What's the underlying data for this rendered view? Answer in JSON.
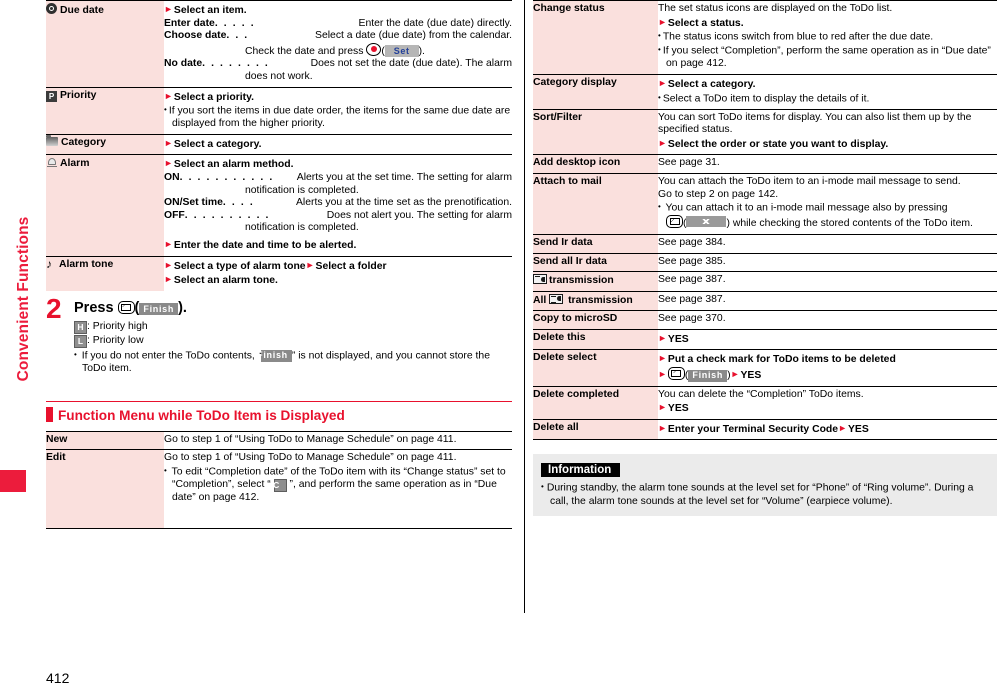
{
  "chapter": {
    "label": "Convenient Functions"
  },
  "page": {
    "number": "412"
  },
  "left_table": {
    "rows": [
      {
        "icon": "due-date-icon",
        "term": "Due date",
        "head": "Select an item.",
        "defs": [
          {
            "term": "Enter date",
            "dots": ". . . . .",
            "body": "Enter the date (due date) directly."
          },
          {
            "term": "Choose date",
            "dots": ". . .",
            "body": "Select a date (due date) from the calendar.",
            "cont_pre": "Check the date and press ",
            "cont_key": "center-key",
            "cont_soft": "Set",
            "cont_post": ")."
          },
          {
            "term": "No date",
            "dots": ". . . . . . . .",
            "body": "Does not set the date (due date). The alarm",
            "cont": "does not work."
          }
        ]
      },
      {
        "icon": "priority-icon",
        "term": "Priority",
        "head": "Select a priority.",
        "notes": [
          "If you sort the items in due date order, the items for the same due date are displayed from the higher priority."
        ]
      },
      {
        "icon": "category-folder-icon",
        "term": "Category",
        "head": "Select a category."
      },
      {
        "icon": "alarm-bell-icon",
        "term": "Alarm",
        "head": "Select an alarm method.",
        "defs": [
          {
            "term": "ON",
            "dots": ". . . . . . . . . . .",
            "body": "Alerts you at the set time. The setting for alarm",
            "cont": "notification is completed."
          },
          {
            "term": "ON/Set time",
            "dots": ". . . .",
            "body": "Alerts you at the time set as the prenotification."
          },
          {
            "term": "OFF",
            "dots": ". . . . . . . . . .",
            "body": "Does not alert you. The setting for alarm",
            "cont": "notification is completed."
          }
        ],
        "head2": "Enter the date and time to be alerted."
      },
      {
        "icon": "music-note-icon",
        "term": "Alarm tone",
        "head": "Select a type of alarm tone",
        "head_b": "Select a folder",
        "head2": "Select an alarm tone."
      }
    ]
  },
  "step": {
    "number": "2",
    "title_pre": "Press ",
    "title_key": "mail-key",
    "title_soft": "Finish",
    "title_post": ").",
    "lines": [
      {
        "icon": "H",
        "text": ": Priority high"
      },
      {
        "icon": "L",
        "text": ": Priority low"
      }
    ],
    "note_pre": "If you do not enter the ToDo contents, “",
    "note_soft": "Finish",
    "note_post": "” is not displayed, and you cannot store the ToDo item."
  },
  "section_header": {
    "title": "Function Menu while ToDo Item is Displayed"
  },
  "left_table2": {
    "rows": [
      {
        "term": "New",
        "body": "Go to step 1 of “Using ToDo to Manage Schedule” on page 411."
      },
      {
        "term": "Edit",
        "body": "Go to step 1 of “Using ToDo to Manage Schedule” on page 411.",
        "note_pre": "To edit “Completion date” of the ToDo item with its “Change status” set to “Completion”, select “ ",
        "note_icon": "C",
        "note_post": " ”, and perform the same operation as in “Due date” on page 412."
      }
    ]
  },
  "right_table": {
    "rows": [
      {
        "term": "Change status",
        "body": "The set status icons are displayed on the ToDo list.",
        "head": "Select a status.",
        "notes": [
          "The status icons switch from blue to red after the due date.",
          "If you select “Completion”, perform the same operation as in “Due date” on page 412."
        ]
      },
      {
        "term": "Category display",
        "head": "Select a category.",
        "notes": [
          "Select a ToDo item to display the details of it."
        ]
      },
      {
        "term": "Sort/Filter",
        "body": "You can sort ToDo items for display. You can also list them up by the specified status.",
        "head": "Select the order or state you want to display."
      },
      {
        "term": "Add desktop icon",
        "body": "See page 31."
      },
      {
        "term": "Attach to mail",
        "body": "You can attach the ToDo item to an i-mode mail message to send.",
        "body2": "Go to step 2 on page 142.",
        "note_pre": "You can attach it to an i-mode mail message also by pressing",
        "note_key": "mail-key",
        "note_soft": "mail-softkey",
        "note_post": ") while checking the stored contents of the ToDo item."
      },
      {
        "term": "Send Ir data",
        "body": "See page 384."
      },
      {
        "term": "Send all Ir data",
        "body": "See page 385."
      },
      {
        "term_icon": "transmission-icon",
        "term": "transmission",
        "body": "See page 387."
      },
      {
        "term_pre": "All",
        "term_icon": "transmission-icon",
        "term": "transmission",
        "body": "See page 387."
      },
      {
        "term": "Copy to microSD",
        "body": "See page 370."
      },
      {
        "term": "Delete this",
        "head": "YES"
      },
      {
        "term": "Delete select",
        "head": "Put a check mark for ToDo items to be deleted",
        "head2_key": "mail-key",
        "head2_soft": "Finish",
        "head2_post": "YES"
      },
      {
        "term": "Delete completed",
        "body": "You can delete the “Completion” ToDo items.",
        "head": "YES"
      },
      {
        "term": "Delete all",
        "head": "Enter your Terminal Security Code",
        "head_b": "YES"
      }
    ]
  },
  "information": {
    "title": "Information",
    "items": [
      "During standby, the alarm tone sounds at the level set for “Phone” of “Ring volume”. During a call, the alarm tone sounds at the level set for “Volume” (earpiece volume)."
    ]
  },
  "colors": {
    "accent_red": "#e8112d",
    "term_bg": "#fae0dd",
    "info_bg": "#ebebeb"
  }
}
